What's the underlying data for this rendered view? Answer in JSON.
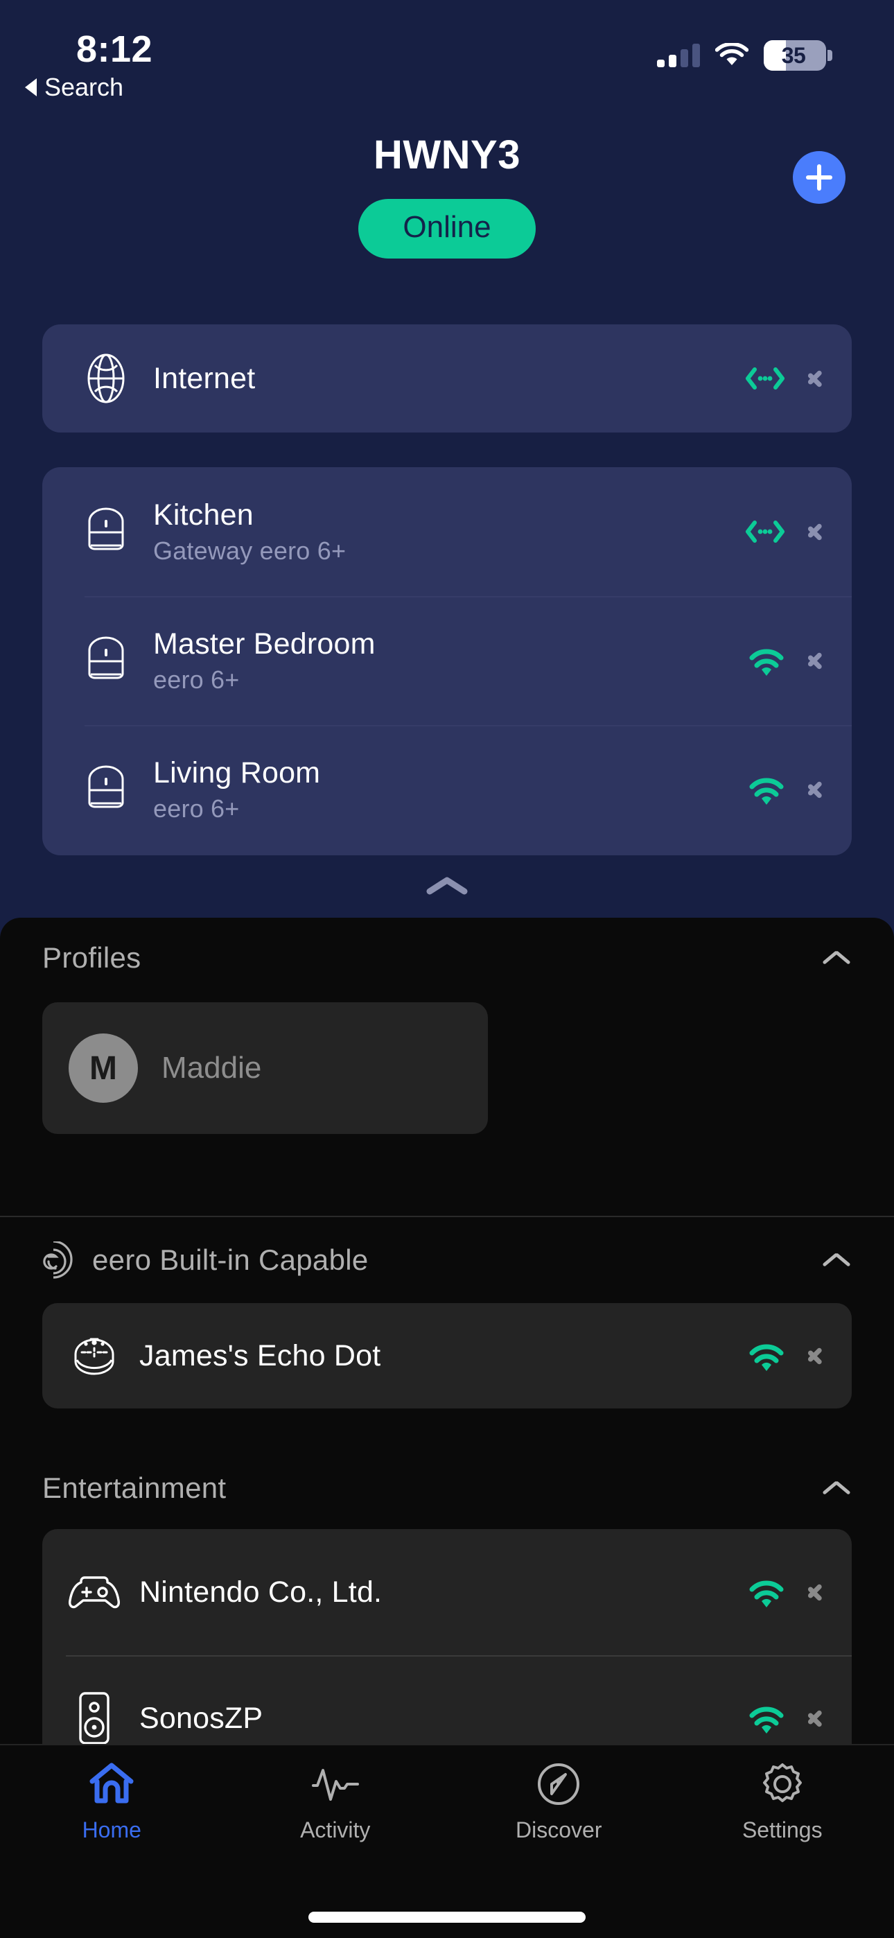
{
  "status_bar": {
    "time": "8:12",
    "battery_percent": "35",
    "cellular_icon": "cellular-signal-icon",
    "wifi_icon": "wifi-icon",
    "battery_icon": "battery-icon"
  },
  "back_link": {
    "label": "Search",
    "icon": "back-triangle-icon"
  },
  "header": {
    "network_name": "HWNY3",
    "status_pill": "Online",
    "add_button_icon": "plus-icon",
    "accent_blue": "#4a7dfc",
    "accent_green": "#0ccb97"
  },
  "internet": {
    "label": "Internet",
    "icon": "globe-icon",
    "connection_icon": "ethernet-icon",
    "chevron_icon": "chevron-right-icon"
  },
  "eeros": [
    {
      "name": "Kitchen",
      "model": "Gateway eero 6+",
      "icon": "eero-device-icon",
      "connection_icon": "ethernet-icon",
      "chevron_icon": "chevron-right-icon"
    },
    {
      "name": "Master Bedroom",
      "model": "eero 6+",
      "icon": "eero-device-icon",
      "connection_icon": "wifi-signal-icon",
      "chevron_icon": "chevron-right-icon"
    },
    {
      "name": "Living Room",
      "model": "eero 6+",
      "icon": "eero-device-icon",
      "connection_icon": "wifi-signal-icon",
      "chevron_icon": "chevron-right-icon"
    }
  ],
  "collapse_handle_icon": "chevron-up-icon",
  "sections": {
    "profiles": {
      "title": "Profiles",
      "caret_icon": "chevron-up-icon",
      "items": [
        {
          "name": "Maddie",
          "initial": "M",
          "avatar_icon": "avatar"
        }
      ]
    },
    "eero_builtin": {
      "title": "eero Built-in Capable",
      "section_icon": "eero-builtin-logo-icon",
      "caret_icon": "chevron-up-icon",
      "items": [
        {
          "name": "James's Echo Dot",
          "icon": "echo-dot-icon",
          "connection_icon": "wifi-signal-icon",
          "chevron_icon": "chevron-right-icon"
        }
      ]
    },
    "entertainment": {
      "title": "Entertainment",
      "caret_icon": "chevron-up-icon",
      "items": [
        {
          "name": "Nintendo Co., Ltd.",
          "icon": "gamepad-icon",
          "connection_icon": "wifi-signal-icon",
          "chevron_icon": "chevron-right-icon"
        },
        {
          "name": "SonosZP",
          "icon": "speaker-icon",
          "connection_icon": "wifi-signal-icon",
          "chevron_icon": "chevron-right-icon"
        }
      ]
    }
  },
  "tab_bar": {
    "active": "Home",
    "tabs": [
      {
        "label": "Home",
        "icon": "home-icon"
      },
      {
        "label": "Activity",
        "icon": "activity-pulse-icon"
      },
      {
        "label": "Discover",
        "icon": "compass-icon"
      },
      {
        "label": "Settings",
        "icon": "gear-icon"
      }
    ]
  }
}
